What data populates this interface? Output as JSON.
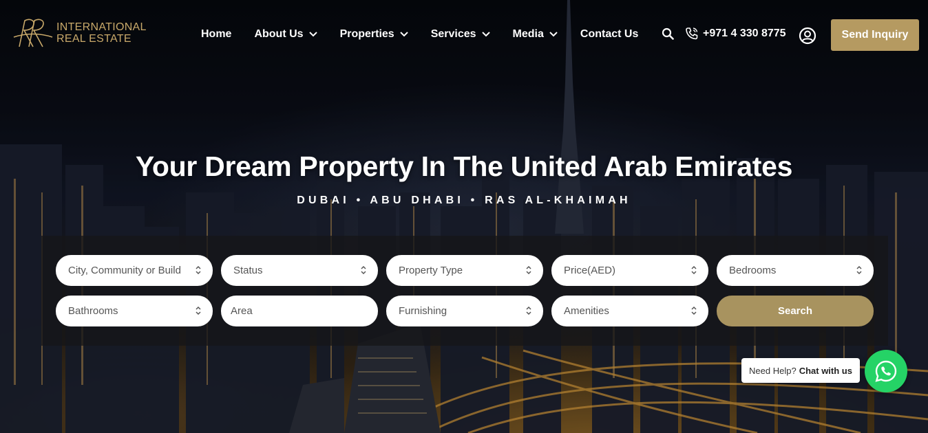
{
  "brand": {
    "name_line1": "INTERNATIONAL",
    "name_line2": "REAL ESTATE",
    "accent": "#b59a61",
    "logo_icon": "rr-monogram-logo"
  },
  "nav": {
    "items": [
      {
        "label": "Home",
        "dropdown": false
      },
      {
        "label": "About Us",
        "dropdown": true
      },
      {
        "label": "Properties",
        "dropdown": true
      },
      {
        "label": "Services",
        "dropdown": true
      },
      {
        "label": "Media",
        "dropdown": true
      },
      {
        "label": "Contact Us",
        "dropdown": false
      }
    ],
    "phone": "+971 4 330 8775",
    "inquiry_label": "Send Inquiry",
    "icons": [
      "search-icon",
      "phone-icon",
      "user-icon",
      "chevron-down-icon"
    ]
  },
  "hero": {
    "title": "Your Dream Property In The United Arab Emirates",
    "subtitle": "DUBAI • ABU DHABI • RAS AL-KHAIMAH"
  },
  "search": {
    "row1": [
      {
        "label": "City, Community or Build"
      },
      {
        "label": "Status"
      },
      {
        "label": "Property Type"
      },
      {
        "label": "Price(AED)"
      },
      {
        "label": "Bedrooms"
      }
    ],
    "row2": [
      {
        "label": "Bathrooms"
      },
      {
        "label": "Area"
      },
      {
        "label": "Furnishing"
      },
      {
        "label": "Amenities"
      }
    ],
    "area_placeholder": "Area",
    "search_label": "Search",
    "button_color": "#a8935f"
  },
  "chat": {
    "prefix": "Need Help?",
    "cta": "Chat with us",
    "whatsapp_color": "#25d366",
    "icon": "whatsapp-icon"
  }
}
